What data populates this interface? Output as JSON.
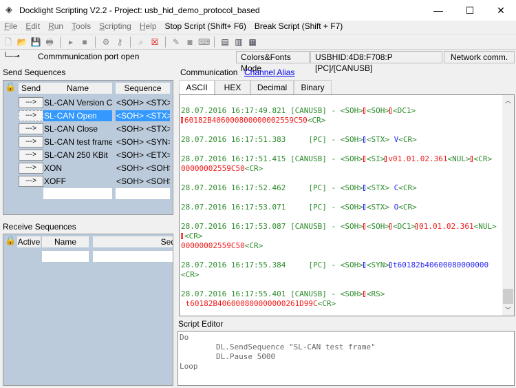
{
  "window": {
    "title": "Docklight Scripting V2.2 - Project: usb_hid_demo_protocol_based",
    "minimize": "—",
    "maximize": "☐",
    "close": "✕"
  },
  "menu": [
    {
      "label": "File",
      "u": "F",
      "rest": "ile",
      "disabled": true
    },
    {
      "label": "Edit",
      "u": "E",
      "rest": "dit",
      "disabled": true
    },
    {
      "label": "Run",
      "u": "R",
      "rest": "un",
      "disabled": true
    },
    {
      "label": "Tools",
      "u": "T",
      "rest": "ools",
      "disabled": true
    },
    {
      "label": "Scripting",
      "u": "S",
      "rest": "cripting",
      "disabled": true
    },
    {
      "label": "Help",
      "u": "H",
      "rest": "elp",
      "disabled": true
    },
    {
      "label": "Stop Script  (Shift+ F6)"
    },
    {
      "label": "Break Script (Shift + F7)"
    }
  ],
  "toolbar": [
    "new-icon",
    "open-icon",
    "save-icon",
    "print-icon",
    "|",
    "run-icon",
    "stop-icon",
    "|",
    "settings-icon",
    "key-icon",
    "|",
    "find-icon",
    "clear-icon",
    "|",
    "edit-icon",
    "snapshot-icon",
    "keyboard-icon",
    "|",
    "log-icon",
    "log-pause-icon",
    "log-stop-icon"
  ],
  "status": {
    "port": "Commmunication port open",
    "mode": "Colors&Fonts Mode",
    "device": "USBHID:4D8:F708:P [PC]/[CANUSB]",
    "network": "Network comm."
  },
  "send": {
    "title": "Send Sequences",
    "headers": {
      "send": "Send",
      "name": "Name",
      "sequence": "Sequence"
    },
    "button": "--->",
    "rows": [
      {
        "name": "SL-CAN Version C...",
        "seq": "<SOH> <STX>"
      },
      {
        "name": "SL-CAN Open",
        "seq": "<SOH> <STX>",
        "selected": true
      },
      {
        "name": "SL-CAN Close",
        "seq": "<SOH> <STX>"
      },
      {
        "name": "SL-CAN test frame",
        "seq": "<SOH> <SYN>"
      },
      {
        "name": "SL-CAN 250 KBit",
        "seq": "<SOH> <ETX>"
      },
      {
        "name": "XON",
        "seq": "<SOH> <SOH>"
      },
      {
        "name": "XOFF",
        "seq": "<SOH> <SOH>"
      }
    ]
  },
  "receive": {
    "title": "Receive Sequences",
    "headers": {
      "active": "Active",
      "name": "Name",
      "sequence": "Seq"
    }
  },
  "comm": {
    "title": "Communication",
    "channel_alias": "Channel Alias",
    "tabs": [
      "ASCII",
      "HEX",
      "Decimal",
      "Binary"
    ],
    "active_tab": 0,
    "lines": [
      {
        "row": 0,
        "segs": [
          [
            "g",
            "28.07.2016 16:17:49.821 [CANUSB] - <SOH>"
          ],
          [
            "xr",
            ""
          ],
          [
            "g",
            "<SOH>"
          ],
          [
            "xr",
            ""
          ],
          [
            "g",
            "<DC1>"
          ]
        ]
      },
      {
        "row": 1,
        "segs": [
          [
            "xr",
            ""
          ],
          [
            "r",
            "60182B406000800000002559C50"
          ],
          [
            "g",
            "<CR>"
          ]
        ]
      },
      {
        "row": 3,
        "segs": [
          [
            "g",
            "28.07.2016 16:17:51.383     [PC] - <SOH>"
          ],
          [
            "xb",
            ""
          ],
          [
            "g",
            "<STX> "
          ],
          [
            "b",
            "V"
          ],
          [
            "g",
            "<CR>"
          ]
        ]
      },
      {
        "row": 5,
        "segs": [
          [
            "g",
            "28.07.2016 16:17:51.415 [CANUSB] - <SOH>"
          ],
          [
            "xr",
            ""
          ],
          [
            "g",
            "<SI>"
          ],
          [
            "xr",
            ""
          ],
          [
            "r",
            "v01.01.02.361"
          ],
          [
            "g",
            "<NUL>"
          ],
          [
            "xr",
            ""
          ],
          [
            "g",
            "<CR>"
          ]
        ]
      },
      {
        "row": 6,
        "segs": [
          [
            "r",
            "00000002559C50"
          ],
          [
            "g",
            "<CR>"
          ]
        ]
      },
      {
        "row": 8,
        "segs": [
          [
            "g",
            "28.07.2016 16:17:52.462     [PC] - <SOH>"
          ],
          [
            "xb",
            ""
          ],
          [
            "g",
            "<STX> "
          ],
          [
            "b",
            "C"
          ],
          [
            "g",
            "<CR>"
          ]
        ]
      },
      {
        "row": 10,
        "segs": [
          [
            "g",
            "28.07.2016 16:17:53.071     [PC] - <SOH>"
          ],
          [
            "xb",
            ""
          ],
          [
            "g",
            "<STX> "
          ],
          [
            "b",
            "O"
          ],
          [
            "g",
            "<CR>"
          ]
        ]
      },
      {
        "row": 12,
        "segs": [
          [
            "g",
            "28.07.2016 16:17:53.087 [CANUSB] - <SOH>"
          ],
          [
            "xr",
            ""
          ],
          [
            "g",
            "<SOH>"
          ],
          [
            "xr",
            ""
          ],
          [
            "g",
            "<DC1>"
          ],
          [
            "xr",
            ""
          ],
          [
            "r",
            "01.01.02.361"
          ],
          [
            "g",
            "<NUL>"
          ]
        ]
      },
      {
        "row": 13,
        "segs": [
          [
            "xr",
            ""
          ],
          [
            "g",
            "<CR>"
          ]
        ]
      },
      {
        "row": 14,
        "segs": [
          [
            "r",
            "00000002559C50"
          ],
          [
            "g",
            "<CR>"
          ]
        ]
      },
      {
        "row": 16,
        "segs": [
          [
            "g",
            "28.07.2016 16:17:55.384     [PC] - <SOH>"
          ],
          [
            "xb",
            ""
          ],
          [
            "g",
            "<SYN>"
          ],
          [
            "xb",
            ""
          ],
          [
            "b",
            "t60182b40600080000000"
          ]
        ]
      },
      {
        "row": 17,
        "segs": [
          [
            "g",
            "<CR>"
          ]
        ]
      },
      {
        "row": 19,
        "segs": [
          [
            "g",
            "28.07.2016 16:17:55.401 [CANUSB] - <SOH>"
          ],
          [
            "xr",
            ""
          ],
          [
            "g",
            "<RS>"
          ]
        ]
      },
      {
        "row": 20,
        "segs": [
          [
            "r",
            " t60182B406000800000000261D99C"
          ],
          [
            "g",
            "<CR>"
          ]
        ]
      }
    ]
  },
  "editor": {
    "title": "Script Editor",
    "lines": [
      "Do",
      "        DL.SendSequence \"SL-CAN test frame\"",
      "        DL.Pause 5000",
      "Loop"
    ]
  },
  "colors": {
    "panel": "#bccbdb",
    "selected": "#3399ff",
    "green": "#2a8a2a",
    "red": "#f01818",
    "blue": "#2828f0"
  }
}
